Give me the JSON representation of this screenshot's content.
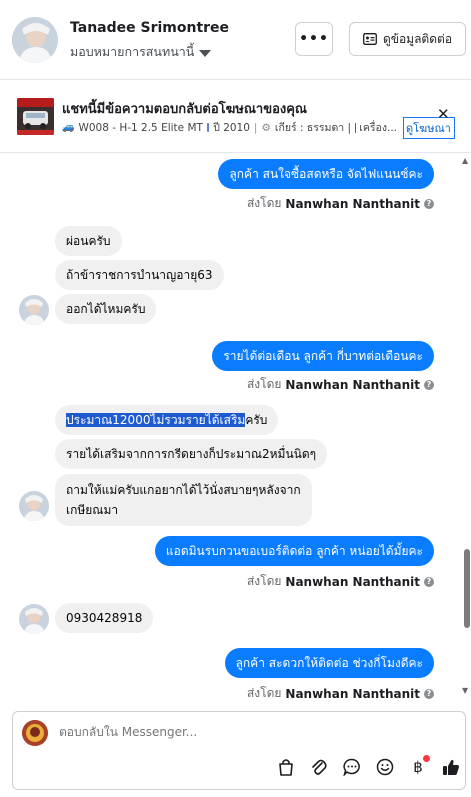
{
  "header": {
    "user_name": "Tanadee Srimontree",
    "assign_label": "มอบหมายการสนทนานี้",
    "more_label": "•••",
    "contact_button": "ดูข้อมูลติดต่อ"
  },
  "ad": {
    "title": "แชทนี้มีข้อความตอบกลับต่อโฆษณาของคุณ",
    "model": "W008 - H-1 2.5 Elite MT",
    "year": "ปี 2010",
    "gear": "เกียร์ : ธรรมดา |",
    "engine": "เครื่อง...",
    "view_ad": "ดูโฆษณา",
    "close": "✕"
  },
  "messages": [
    {
      "dir": "out",
      "text": "ลูกค้า สนใจซื้อสดหรือ จัดไฟแนนซ์คะ"
    },
    {
      "dir": "sent",
      "prefix": "ส่งโดย",
      "name": "Nanwhan Nanthanit"
    },
    {
      "dir": "in",
      "text": "ผ่อนครับ"
    },
    {
      "dir": "in",
      "text": "ถ้าข้าราชการบำนาญอายุ63"
    },
    {
      "dir": "in",
      "text": "ออกได้ไหมครับ"
    },
    {
      "dir": "out",
      "text": "รายได้ต่อเดือน ลูกค้า กี่บาทต่อเดือนคะ"
    },
    {
      "dir": "sent",
      "prefix": "ส่งโดย",
      "name": "Nanwhan Nanthanit"
    },
    {
      "dir": "in",
      "text_highlighted": "ประมาณ12000ไม่รวมรายได้เสริม",
      "text_rest": "ครับ"
    },
    {
      "dir": "in",
      "text": "รายได้เสริมจากการกรีดยางก็ประมาณ2หมื่นนิดๆ"
    },
    {
      "dir": "in",
      "line1": "ถามให้แม่ครับแกอยากได้ไว้นั่งสบายๆหลังจาก",
      "line2": "เกษียณมา"
    },
    {
      "dir": "out",
      "text": "แอดมินรบกวนขอเบอร์ติดต่อ ลูกค้า หน่อยได้มั้ยคะ"
    },
    {
      "dir": "sent",
      "prefix": "ส่งโดย",
      "name": "Nanwhan Nanthanit"
    },
    {
      "dir": "in",
      "text": "0930428918"
    },
    {
      "dir": "out",
      "text": "ลูกค้า สะดวกให้ติดต่อ ช่วงกี่โมงดีคะ"
    },
    {
      "dir": "sent",
      "prefix": "ส่งโดย",
      "name": "Nanwhan Nanthanit"
    }
  ],
  "composer": {
    "placeholder": "ตอบกลับใน Messenger...",
    "tools": [
      "bag-icon",
      "paperclip-icon",
      "chat-icon",
      "emoji-icon",
      "baht-icon",
      "thumbs-up-icon"
    ]
  },
  "colors": {
    "outgoing_bubble": "#0a7cff",
    "incoming_bubble": "#f0f0f0",
    "link": "#0064d1"
  }
}
